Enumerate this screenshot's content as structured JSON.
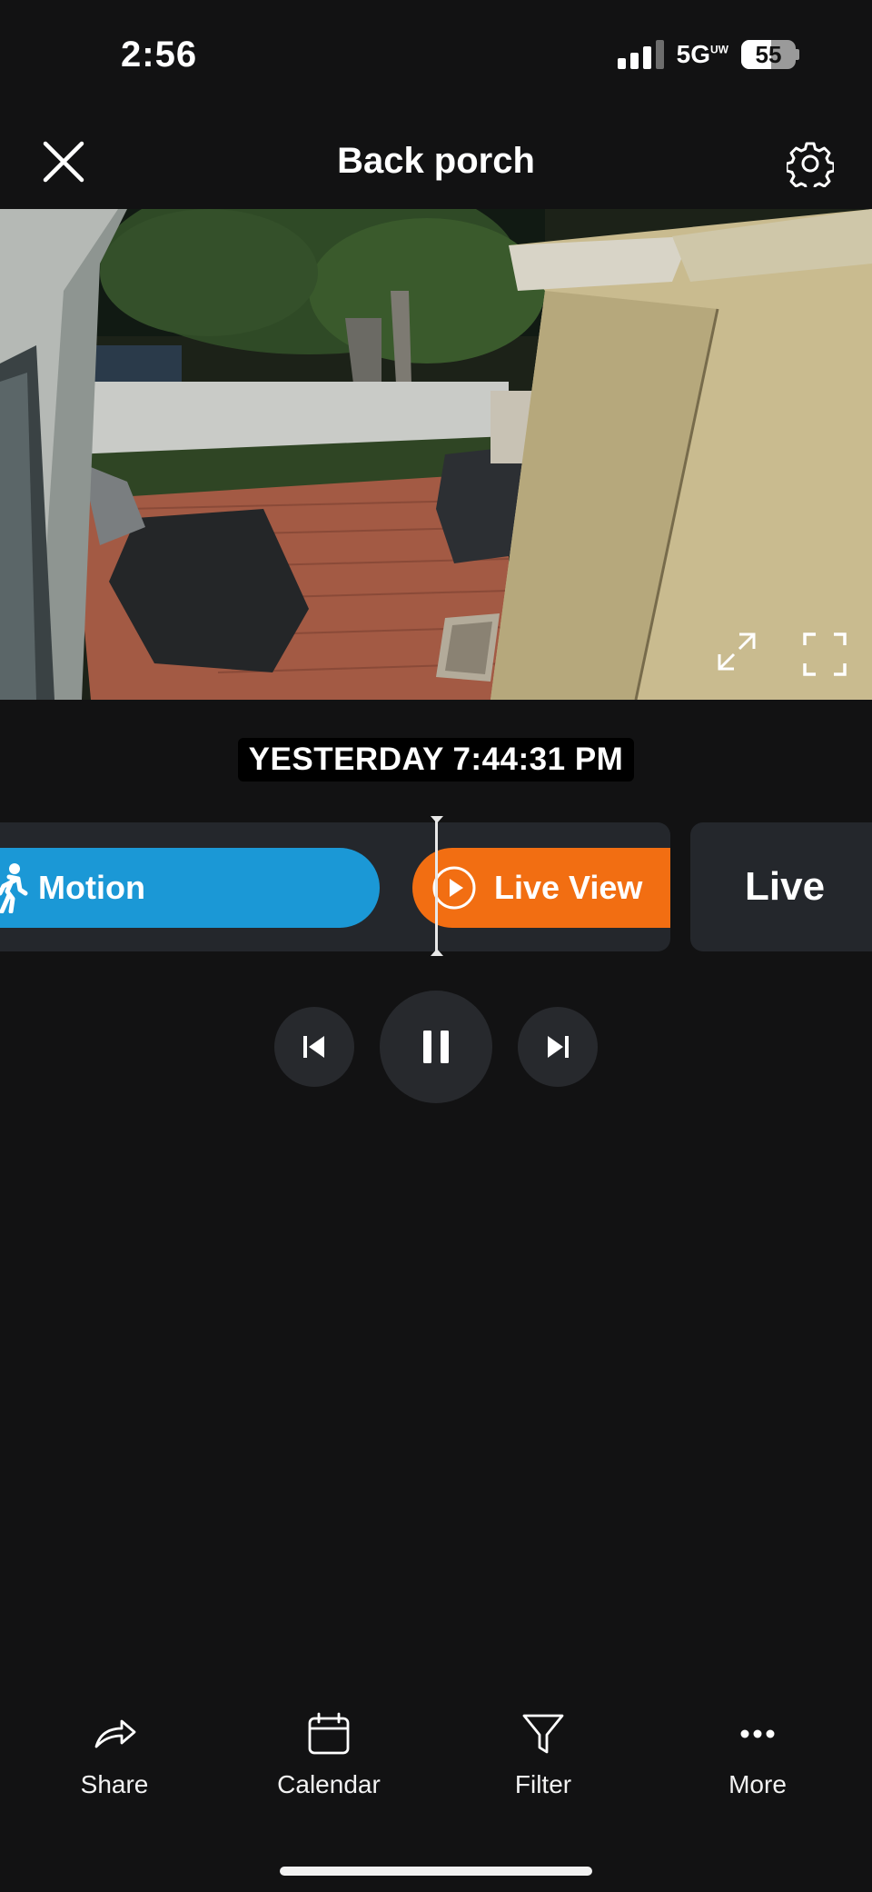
{
  "status_bar": {
    "time": "2:56",
    "network": "5G",
    "network_suffix": "UW",
    "battery": "55"
  },
  "header": {
    "title": "Back porch",
    "close_icon": "close-icon",
    "settings_icon": "gear-icon"
  },
  "camera": {
    "scene": "night porch camera feed",
    "expand_icon": "expand-icon",
    "fullscreen_icon": "fullscreen-icon"
  },
  "timestamp": "YESTERDAY 7:44:31 PM",
  "timeline": {
    "events": [
      {
        "label": "Motion",
        "color": "#1b98d6",
        "icon": "person-walking-icon"
      },
      {
        "label": "Live View",
        "color": "#f26e12",
        "icon": "play-circle-icon"
      }
    ],
    "live_label": "Live"
  },
  "playback": {
    "prev_icon": "skip-previous-icon",
    "pause_icon": "pause-icon",
    "next_icon": "skip-next-icon"
  },
  "bottom_nav": [
    {
      "label": "Share",
      "icon": "share-icon"
    },
    {
      "label": "Calendar",
      "icon": "calendar-icon"
    },
    {
      "label": "Filter",
      "icon": "filter-icon"
    },
    {
      "label": "More",
      "icon": "more-icon"
    }
  ],
  "colors": {
    "background": "#121213",
    "motion": "#1b98d6",
    "live_view": "#f26e12",
    "panel": "#24272c"
  }
}
